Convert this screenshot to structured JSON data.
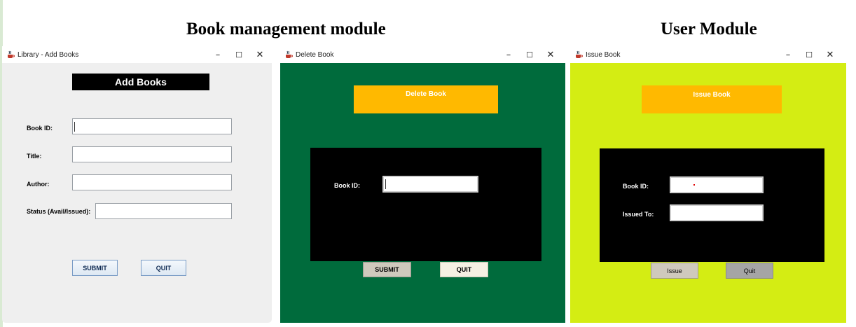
{
  "captions": {
    "book_management": "Book management module",
    "user_module": "User Module"
  },
  "window_controls": {
    "minimize": "–",
    "maximize": "☐",
    "close": "✕"
  },
  "add_books": {
    "window_title": "Library - Add Books",
    "heading": "Add Books",
    "labels": {
      "book_id": "Book ID:",
      "title": "Title:",
      "author": "Author:",
      "status": "Status (Avail/Issued):"
    },
    "values": {
      "book_id": "",
      "title": "",
      "author": "",
      "status": ""
    },
    "buttons": {
      "submit": "SUBMIT",
      "quit": "QUIT"
    },
    "colors": {
      "background": "#efefef",
      "heading_bg": "#000000",
      "heading_text": "#ffffff"
    }
  },
  "delete_book": {
    "window_title": "Delete Book",
    "heading": "Delete Book",
    "labels": {
      "book_id": "Book ID:"
    },
    "values": {
      "book_id": ""
    },
    "buttons": {
      "submit": "SUBMIT",
      "quit": "QUIT"
    },
    "colors": {
      "background": "#006b3c",
      "heading_bg": "#ffb900",
      "panel": "#000000"
    }
  },
  "issue_book": {
    "window_title": "Issue Book",
    "heading": "Issue Book",
    "labels": {
      "book_id": "Book ID:",
      "issued_to": "Issued To:"
    },
    "values": {
      "book_id": "",
      "issued_to": ""
    },
    "buttons": {
      "issue": "Issue",
      "quit": "Quit"
    },
    "colors": {
      "background": "#d4ed13",
      "heading_bg": "#ffb900",
      "panel": "#000000"
    }
  }
}
